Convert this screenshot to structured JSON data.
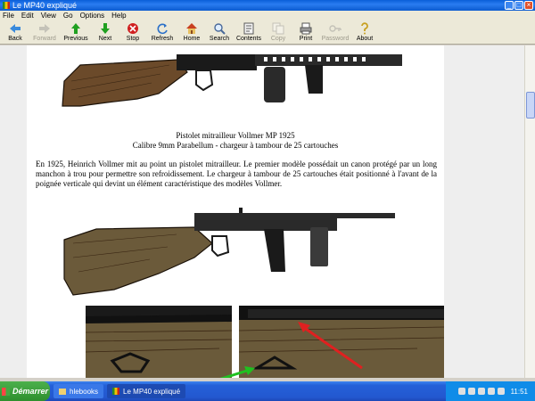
{
  "window": {
    "title": "Le MP40 expliqué"
  },
  "menu": [
    "File",
    "Edit",
    "View",
    "Go",
    "Options",
    "Help"
  ],
  "toolbar": [
    {
      "label": "Back",
      "icon": "back-arrow-icon",
      "enabled": true
    },
    {
      "label": "Forward",
      "icon": "forward-arrow-icon",
      "enabled": false
    },
    {
      "label": "Previous",
      "icon": "up-arrow-icon",
      "enabled": true
    },
    {
      "label": "Next",
      "icon": "down-arrow-icon",
      "enabled": true
    },
    {
      "label": "Stop",
      "icon": "stop-icon",
      "enabled": true
    },
    {
      "label": "Refresh",
      "icon": "refresh-icon",
      "enabled": true
    },
    {
      "label": "Home",
      "icon": "home-icon",
      "enabled": true
    },
    {
      "label": "Search",
      "icon": "search-icon",
      "enabled": true
    },
    {
      "label": "Contents",
      "icon": "contents-icon",
      "enabled": true
    },
    {
      "label": "Copy",
      "icon": "copy-icon",
      "enabled": false
    },
    {
      "label": "Print",
      "icon": "print-icon",
      "enabled": true
    },
    {
      "label": "Password",
      "icon": "password-icon",
      "enabled": false
    },
    {
      "label": "About",
      "icon": "about-icon",
      "enabled": true
    }
  ],
  "content": {
    "caption_line1": "Pistolet mitrailleur Vollmer MP 1925",
    "caption_line2": "Calibre 9mm Parabellum - chargeur à tambour de 25 cartouches",
    "paragraph": "En 1925, Heinrich Vollmer mit au point un pistolet mitrailleur. Le premier modèle possédait un canon protégé par un long manchon à trou pour permettre son refroidissement. Le chargeur à tambour de 25 cartouches était positionné à l'avant de la poignée verticale qui devint un élément caractéristique des modèles Vollmer."
  },
  "taskbar": {
    "start_label": "Démarrer",
    "tasks": [
      {
        "label": "hlebooks",
        "active": false
      },
      {
        "label": "Le MP40 expliqué",
        "active": true
      }
    ],
    "clock": "11:51"
  },
  "colors": {
    "arrow_red": "#e02020",
    "arrow_green": "#20c020"
  }
}
